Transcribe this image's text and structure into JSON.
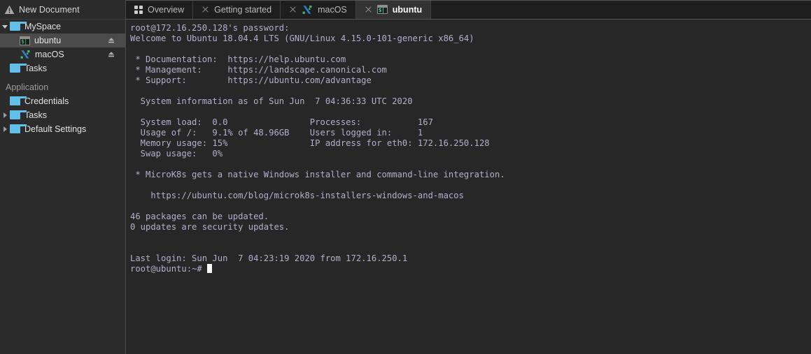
{
  "sidebar": {
    "document_title": "New Document",
    "document_icon": "warning-triangle-icon",
    "tree": [
      {
        "label": "MySpace",
        "icon": "folder-icon",
        "twisty": "open",
        "indent": 0,
        "selected": false,
        "eject": false
      },
      {
        "label": "ubuntu",
        "icon": "terminal-icon",
        "twisty": "none",
        "indent": 2,
        "selected": true,
        "eject": true
      },
      {
        "label": "macOS",
        "icon": "mosh-icon",
        "twisty": "none",
        "indent": 2,
        "selected": false,
        "eject": true
      },
      {
        "label": "Tasks",
        "icon": "folder-icon",
        "twisty": "none",
        "indent": 1,
        "selected": false,
        "eject": false
      }
    ],
    "section_title": "Application",
    "application_tree": [
      {
        "label": "Credentials",
        "icon": "folder-icon",
        "twisty": "none",
        "indent": 1,
        "selected": false,
        "eject": false
      },
      {
        "label": "Tasks",
        "icon": "folder-icon",
        "twisty": "closed",
        "indent": 0,
        "selected": false,
        "eject": false
      },
      {
        "label": "Default Settings",
        "icon": "folder-icon",
        "twisty": "closed",
        "indent": 0,
        "selected": false,
        "eject": false
      }
    ]
  },
  "tabs": [
    {
      "label": "Overview",
      "icon": "grid-icon",
      "closable": false,
      "active": false
    },
    {
      "label": "Getting started",
      "icon": "none",
      "closable": true,
      "active": false
    },
    {
      "label": "macOS",
      "icon": "mosh-icon",
      "closable": true,
      "active": false
    },
    {
      "label": "ubuntu",
      "icon": "terminal-icon",
      "closable": true,
      "active": true
    }
  ],
  "terminal": {
    "prompt_symbol": "root@ubuntu:~#",
    "cursor": "block",
    "lines": [
      "root@172.16.250.128's password:",
      "Welcome to Ubuntu 18.04.4 LTS (GNU/Linux 4.15.0-101-generic x86_64)",
      "",
      " * Documentation:  https://help.ubuntu.com",
      " * Management:     https://landscape.canonical.com",
      " * Support:        https://ubuntu.com/advantage",
      "",
      "  System information as of Sun Jun  7 04:36:33 UTC 2020",
      "",
      "  System load:  0.0                Processes:           167",
      "  Usage of /:   9.1% of 48.96GB    Users logged in:     1",
      "  Memory usage: 15%                IP address for eth0: 172.16.250.128",
      "  Swap usage:   0%",
      "",
      " * MicroK8s gets a native Windows installer and command-line integration.",
      "",
      "    https://ubuntu.com/blog/microk8s-installers-windows-and-macos",
      "",
      "46 packages can be updated.",
      "0 updates are security updates.",
      "",
      "",
      "Last login: Sun Jun  7 04:23:19 2020 from 172.16.250.1"
    ]
  },
  "colors": {
    "sidebar_bg": "#2b2b2b",
    "terminal_bg": "#272727",
    "terminal_fg": "#b5aecb",
    "tabbar_bg": "#1e1e1e",
    "active_tab_bg": "#333333",
    "selection_bg": "#4b4b4b",
    "folder_blue": "#62c0e8",
    "accent_green": "#42d18c"
  }
}
